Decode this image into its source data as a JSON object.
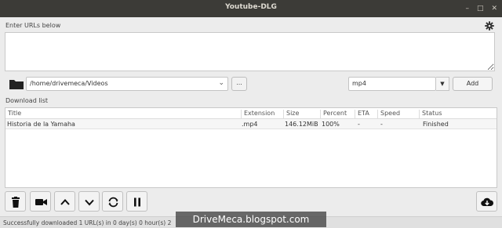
{
  "window": {
    "title": "Youtube-DLG",
    "controls": [
      "–",
      "□",
      "✕"
    ]
  },
  "urls": {
    "label": "Enter URLs below",
    "value": ""
  },
  "path": {
    "value": "/home/drivemeca/Videos",
    "browse_label": "..."
  },
  "format": {
    "value": "mp4",
    "add_label": "Add"
  },
  "download_list": {
    "label": "Download list",
    "columns": [
      "Title",
      "Extension",
      "Size",
      "Percent",
      "ETA",
      "Speed",
      "Status"
    ],
    "rows": [
      {
        "title": "Historia de la Yamaha",
        "extension": ".mp4",
        "size": "146.12MiB",
        "percent": "100%",
        "eta": "-",
        "speed": "-",
        "status": "Finished"
      }
    ]
  },
  "toolbar": {
    "buttons": [
      "delete-icon",
      "video-camera-icon",
      "move-up-icon",
      "move-down-icon",
      "reload-icon",
      "pause-icon"
    ],
    "download_button": "cloud-download-icon"
  },
  "statusbar": {
    "text": "Successfully downloaded 1 URL(s) in 0 day(s) 0 hour(s) 2"
  },
  "watermark": {
    "text": "DriveMeca.blogspot.com"
  }
}
